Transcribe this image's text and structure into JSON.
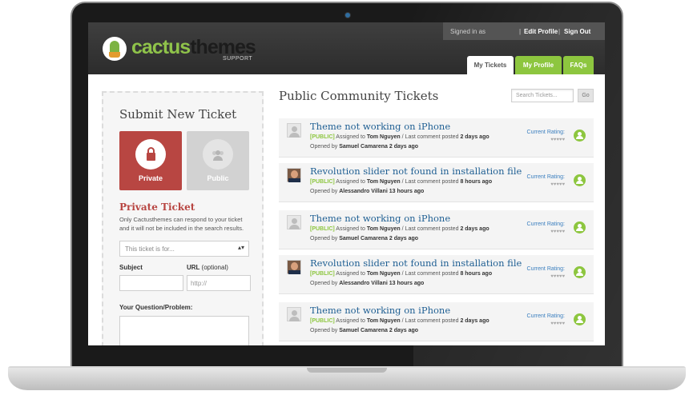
{
  "brand": {
    "name_part1": "cactus",
    "name_part2": "themes",
    "tagline": "SUPPORT"
  },
  "account": {
    "signed_in": "Signed in as",
    "edit_profile": "Edit Profile",
    "separator": "|",
    "sign_out": "Sign Out"
  },
  "tabs": [
    {
      "label": "My Tickets",
      "active": true
    },
    {
      "label": "My Profile",
      "active": false
    },
    {
      "label": "FAQs",
      "active": false
    }
  ],
  "submit_form": {
    "title": "Submit New Ticket",
    "private_label": "Private",
    "public_label": "Public",
    "private_title": "Private Ticket",
    "private_desc": "Only Cactusthemes can respond to your ticket and it will not be included in the search results.",
    "select_placeholder": "This ticket is for...",
    "subject_label": "Subject",
    "url_label": "URL",
    "url_optional": "(optional)",
    "url_placeholder": "http://",
    "question_label": "Your Question/Problem:"
  },
  "public_tickets": {
    "title": "Public Community Tickets",
    "search_placeholder": "Search Tickets...",
    "go_label": "Go",
    "rating_label": "Current Rating:",
    "hearts": "♥♥♥♥♥",
    "items": [
      {
        "title": "Theme not working on iPhone",
        "tag": "[PUBLIC]",
        "assigned_text": "Assigned to",
        "assigned_to": "Tom Nguyen",
        "last_text": "/ Last comment posted",
        "last_comment": "2 days ago",
        "opened_text": "Opened by",
        "opened_by": "Samuel Camarena",
        "opened_ago": "2 days ago",
        "avatar": "default-avatar-icon"
      },
      {
        "title": "Revolution slider not found in installation file",
        "tag": "[PUBLIC]",
        "assigned_text": "Assigned to",
        "assigned_to": "Tom Nguyen",
        "last_text": "/ Last comment posted",
        "last_comment": "8 hours ago",
        "opened_text": "Opened by",
        "opened_by": "Alessandro Villani",
        "opened_ago": "13 hours ago",
        "avatar": "user-photo"
      },
      {
        "title": "Theme not working on iPhone",
        "tag": "[PUBLIC]",
        "assigned_text": "Assigned to",
        "assigned_to": "Tom Nguyen",
        "last_text": "/ Last comment posted",
        "last_comment": "2 days ago",
        "opened_text": "Opened by",
        "opened_by": "Samuel Camarena",
        "opened_ago": "2 days ago",
        "avatar": "default-avatar-icon"
      },
      {
        "title": "Revolution slider not found in installation file",
        "tag": "[PUBLIC]",
        "assigned_text": "Assigned to",
        "assigned_to": "Tom Nguyen",
        "last_text": "/ Last comment posted",
        "last_comment": "8 hours ago",
        "opened_text": "Opened by",
        "opened_by": "Alessandro Villani",
        "opened_ago": "13 hours ago",
        "avatar": "user-photo"
      },
      {
        "title": "Theme not working on iPhone",
        "tag": "[PUBLIC]",
        "assigned_text": "Assigned to",
        "assigned_to": "Tom Nguyen",
        "last_text": "/ Last comment posted",
        "last_comment": "2 days ago",
        "opened_text": "Opened by",
        "opened_by": "Samuel Camarena",
        "opened_ago": "2 days ago",
        "avatar": "default-avatar-icon"
      }
    ]
  },
  "colors": {
    "accent_green": "#8dc63f",
    "private_red": "#b84642",
    "link_blue": "#1f5f93",
    "header_dark": "#333333"
  }
}
